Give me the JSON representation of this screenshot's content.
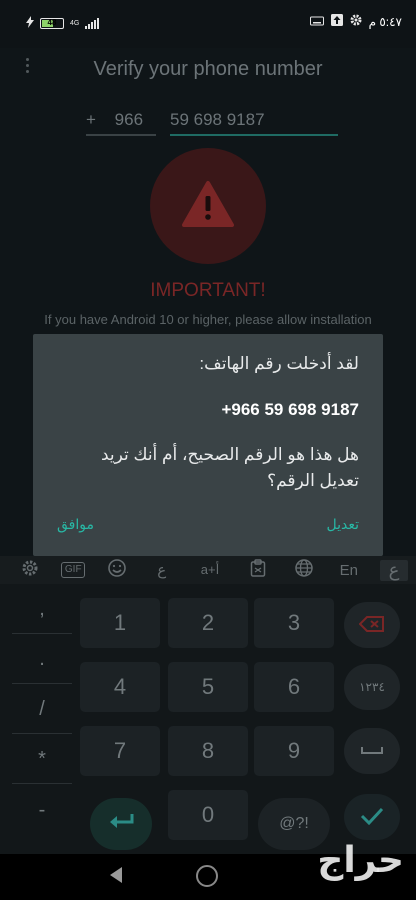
{
  "status_bar": {
    "battery": "48",
    "network": "4G",
    "time": "٥:٤٧ م"
  },
  "app": {
    "title": "Verify your phone number",
    "country_code_prefix": "+",
    "country_code": "966",
    "phone_number": "59 698 9187",
    "important_label": "IMPORTANT!",
    "hint_text": "If you have Android 10 or higher, please allow installation"
  },
  "dialog": {
    "line1": "لقد أدخلت رقم الهاتف:",
    "number": "+966 59 698 9187",
    "question": "هل هذا هو الرقم الصحيح، أم أنك تريد تعديل الرقم؟",
    "edit_button": "تعديل",
    "ok_button": "موافق"
  },
  "keyboard": {
    "toolbar": {
      "gif": "GIF",
      "arabic_letter": "ع",
      "font_size": "a+أ",
      "lang_en": "En",
      "lang_ar": "ع"
    },
    "side_keys": [
      ",",
      ".",
      "/",
      "*",
      "-"
    ],
    "digits": [
      "1",
      "2",
      "3",
      "4",
      "5",
      "6",
      "7",
      "8",
      "9",
      "0"
    ],
    "arabic_numerals_key": "١٢٣٤",
    "symbols_key": "@?!"
  },
  "watermark": "حراج",
  "colors": {
    "accent": "#28b8a5",
    "warning": "#8a2a2a",
    "dialog_bg": "#3a4346",
    "background": "#0f1518"
  }
}
